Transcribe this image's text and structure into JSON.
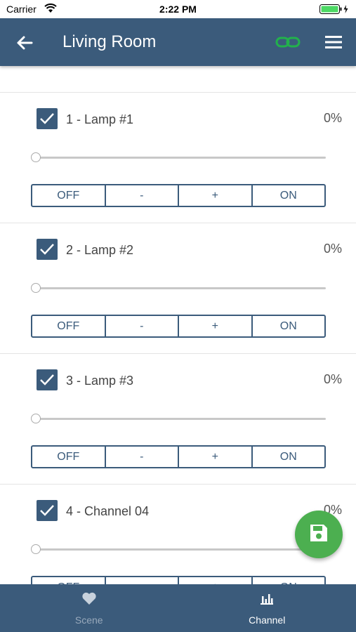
{
  "status_bar": {
    "carrier": "Carrier",
    "time": "2:22 PM"
  },
  "header": {
    "title": "Living Room",
    "back_icon": "back-arrow-icon",
    "link_icon": "link-icon",
    "menu_icon": "hamburger-menu-icon",
    "link_color": "#22b14c"
  },
  "channels": [
    {
      "name": "1 - Lamp #1",
      "percent": "0%",
      "checked": true,
      "level": 0
    },
    {
      "name": "2 - Lamp #2",
      "percent": "0%",
      "checked": true,
      "level": 0
    },
    {
      "name": "3 - Lamp #3",
      "percent": "0%",
      "checked": true,
      "level": 0
    },
    {
      "name": "4 - Channel 04",
      "percent": "0%",
      "checked": true,
      "level": 0
    }
  ],
  "buttons": {
    "off": "OFF",
    "minus": "-",
    "plus": "+",
    "on": "ON"
  },
  "fab": {
    "icon": "save-icon",
    "color": "#4caf50"
  },
  "tabs": [
    {
      "label": "Scene",
      "icon": "heart-icon",
      "active": false
    },
    {
      "label": "Channel",
      "icon": "bar-chart-icon",
      "active": true
    }
  ],
  "colors": {
    "primary": "#3b5b7b",
    "accent": "#4caf50"
  }
}
